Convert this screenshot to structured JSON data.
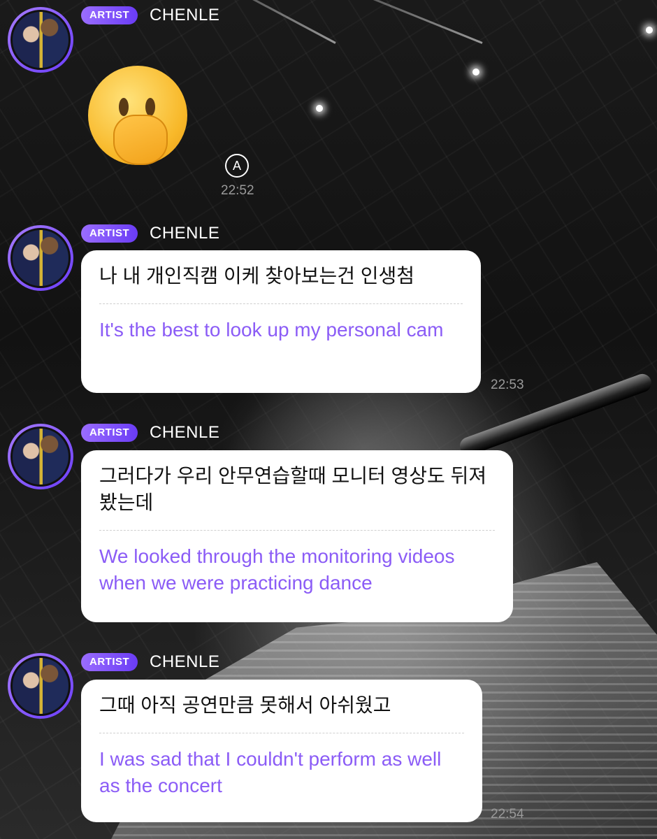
{
  "messages": [
    {
      "badge": "ARTIST",
      "sender": "CHENLE",
      "avatar_icon": "profile-photo",
      "content_type": "emoji",
      "emoji_icon": "face-with-hand-over-mouth",
      "translate_icon": "auto-translate-icon",
      "translate_glyph": "A",
      "time": "22:52"
    },
    {
      "badge": "ARTIST",
      "sender": "CHENLE",
      "original": "나 내 개인직캠 이케 찾아보는건 인생첨",
      "translation": "It's the best to look up my personal cam",
      "time": "22:53"
    },
    {
      "badge": "ARTIST",
      "sender": "CHENLE",
      "original": "그러다가 우리 안무연습할때 모니터 영상도 뒤져봤는데",
      "translation": "We looked through the monitoring videos when we were practicing dance"
    },
    {
      "badge": "ARTIST",
      "sender": "CHENLE",
      "original": "그때 아직 공연만큼 못해서 아쉬웠고",
      "translation": "I was sad that I couldn't perform as well as the concert",
      "time": "22:54"
    }
  ],
  "colors": {
    "badge_start": "#9a6dff",
    "badge_end": "#6a3cf5",
    "translation_text": "#8b5cf6",
    "bubble": "#ffffff"
  }
}
